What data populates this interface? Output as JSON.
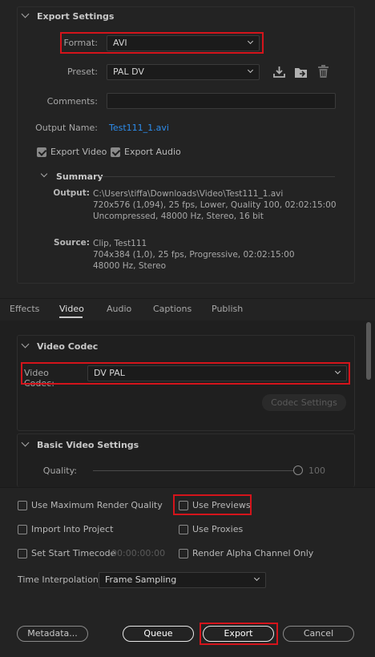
{
  "export_settings": {
    "title": "Export Settings",
    "format_label": "Format:",
    "format_value": "AVI",
    "preset_label": "Preset:",
    "preset_value": "PAL DV",
    "comments_label": "Comments:",
    "comments_value": "",
    "output_name_label": "Output Name:",
    "output_name_value": "Test111_1.avi",
    "export_video_label": "Export Video",
    "export_video_checked": true,
    "export_audio_label": "Export Audio",
    "export_audio_checked": true
  },
  "summary": {
    "title": "Summary",
    "output_label": "Output:",
    "output_lines": [
      "C:\\Users\\tiffa\\Downloads\\Video\\Test111_1.avi",
      "720x576 (1,094), 25 fps, Lower, Quality 100, 02:02:15:00",
      "Uncompressed, 48000 Hz, Stereo, 16 bit"
    ],
    "source_label": "Source:",
    "source_lines": [
      "Clip, Test111",
      "704x384 (1,0), 25 fps, Progressive, 02:02:15:00",
      "48000 Hz, Stereo"
    ]
  },
  "tabs": [
    {
      "label": "Effects",
      "active": false
    },
    {
      "label": "Video",
      "active": true
    },
    {
      "label": "Audio",
      "active": false
    },
    {
      "label": "Captions",
      "active": false
    },
    {
      "label": "Publish",
      "active": false
    }
  ],
  "video_codec": {
    "title": "Video Codec",
    "codec_label": "Video Codec:",
    "codec_value": "DV PAL",
    "codec_settings_button": "Codec Settings"
  },
  "basic_video": {
    "title": "Basic Video Settings",
    "quality_label": "Quality:",
    "quality_value": "100"
  },
  "options": {
    "use_max_render_quality": "Use Maximum Render Quality",
    "use_previews": "Use Previews",
    "import_into_project": "Import Into Project",
    "use_proxies": "Use Proxies",
    "set_start_timecode": "Set Start Timecode",
    "start_timecode_value": "00:00:00:00",
    "render_alpha": "Render Alpha Channel Only",
    "time_interpolation_label": "Time Interpolation:",
    "time_interpolation_value": "Frame Sampling"
  },
  "buttons": {
    "metadata": "Metadata...",
    "queue": "Queue",
    "export": "Export",
    "cancel": "Cancel"
  },
  "colors": {
    "highlight_red": "#d4141b",
    "link_blue": "#2d8ceb",
    "panel_bg": "#232323"
  }
}
